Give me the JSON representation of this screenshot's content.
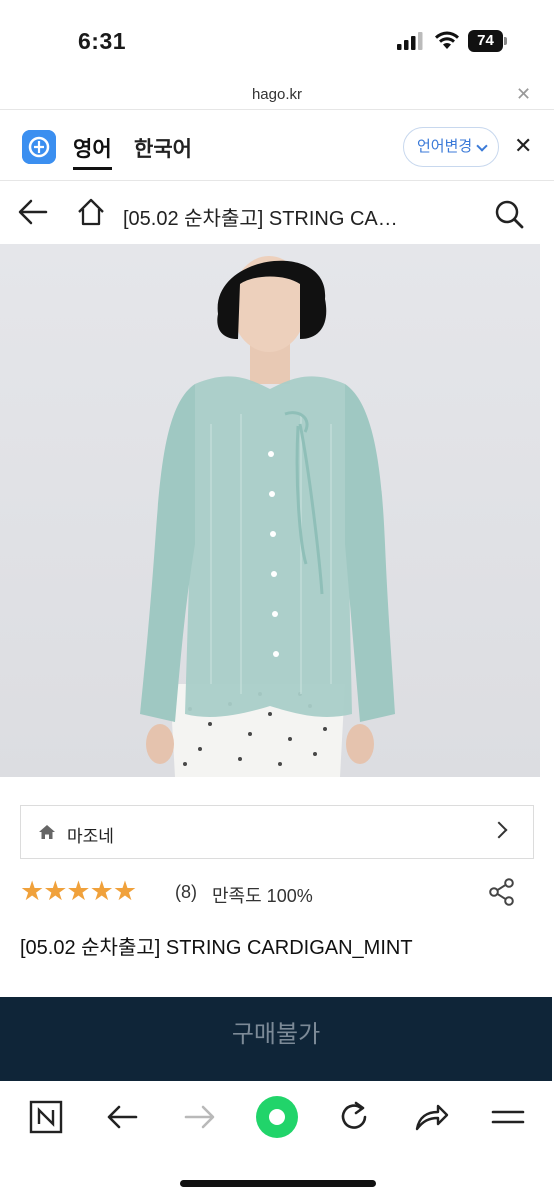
{
  "status_bar": {
    "time": "6:31",
    "battery": "74"
  },
  "browser": {
    "url": "hago.kr",
    "close_icon": "close-icon"
  },
  "translate_bar": {
    "lang_selected": "영어",
    "lang_other": "한국어",
    "change_button": "언어변경",
    "accent_color": "#3b7ad8"
  },
  "header": {
    "title": "[05.02 순차출고] STRING CA…"
  },
  "product": {
    "shop_name": "마조네",
    "stars": "★★★★★",
    "review_count": "(8)",
    "satisfaction": "만족도 100%",
    "title": "[05.02 순차출고] STRING CARDIGAN_MINT",
    "buy_button": "구매불가",
    "rating_color": "#f0a13b",
    "buy_bg_color": "#0f2538"
  },
  "toolbar": {
    "icons": [
      "naver-home-icon",
      "back-arrow-icon",
      "forward-arrow-icon",
      "green-dot-icon",
      "refresh-icon",
      "share-icon",
      "menu-icon"
    ]
  }
}
